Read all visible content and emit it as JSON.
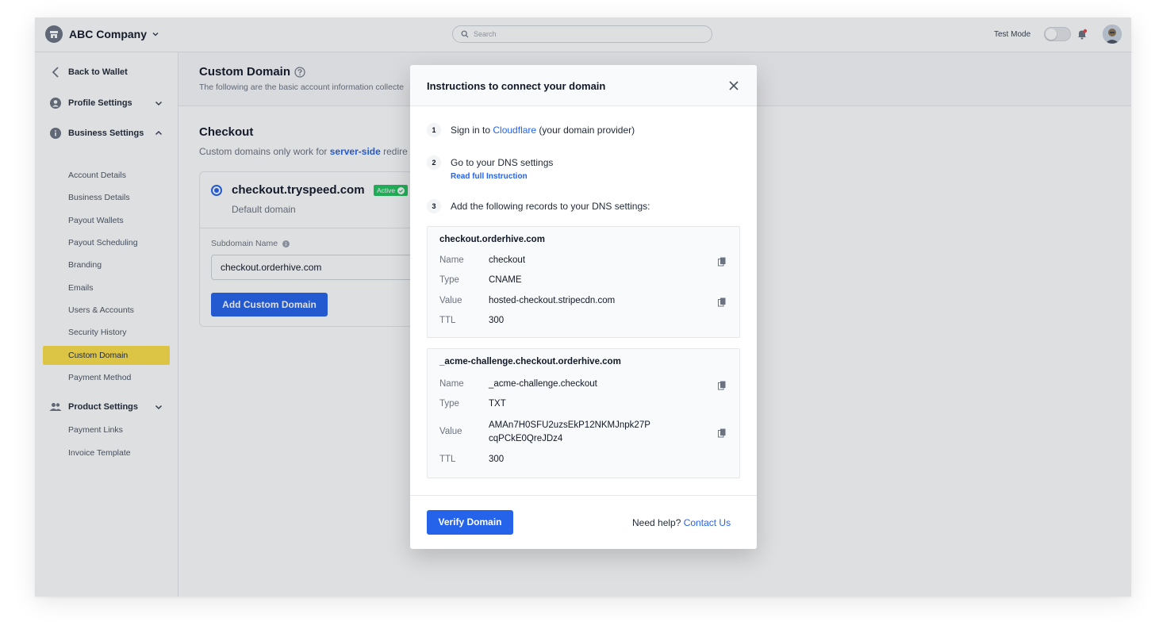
{
  "topbar": {
    "company": "ABC Company",
    "search_placeholder": "Search",
    "test_mode_label": "Test Mode"
  },
  "sidebar": {
    "back": "Back to Wallet",
    "profile_settings": "Profile Settings",
    "business_settings": "Business Settings",
    "business_items": [
      "Account Details",
      "Business Details",
      "Payout Wallets",
      "Payout Scheduling",
      "Branding",
      "Emails",
      "Users & Accounts",
      "Security History",
      "Custom Domain",
      "Payment Method"
    ],
    "product_settings": "Product Settings",
    "product_items": [
      "Payment Links",
      "Invoice Template"
    ]
  },
  "main": {
    "title": "Custom Domain",
    "description": "The following are the basic account information collecte",
    "section_title": "Checkout",
    "section_desc_prefix": "Custom domains only work for ",
    "section_desc_link": "server-side",
    "section_desc_suffix": " redire",
    "domain_name": "checkout.tryspeed.com",
    "badge": "Active",
    "default_label": "Default domain",
    "subdomain_label": "Subdomain Name",
    "subdomain_value": "checkout.orderhive.com",
    "add_button": "Add Custom Domain"
  },
  "modal": {
    "title": "Instructions to connect your domain",
    "steps": [
      {
        "num": "1",
        "prefix": "Sign in to ",
        "link": "Cloudflare",
        "suffix": " (your domain provider)"
      },
      {
        "num": "2",
        "text": "Go to your DNS settings",
        "sub_link": "Read full Instruction"
      },
      {
        "num": "3",
        "text": "Add the following records to your DNS settings:"
      }
    ],
    "records": [
      {
        "title": "checkout.orderhive.com",
        "name_label": "Name",
        "name": "checkout",
        "type_label": "Type",
        "type": "CNAME",
        "value_label": "Value",
        "value": "hosted-checkout.stripecdn.com",
        "ttl_label": "TTL",
        "ttl": "300"
      },
      {
        "title": "_acme-challenge.checkout.orderhive.com",
        "name_label": "Name",
        "name": "_acme-challenge.checkout",
        "type_label": "Type",
        "type": "TXT",
        "value_label": "Value",
        "value_line1": "AMAn7H0SFU2uzsEkP12NKMJnpk27P",
        "value_line2": "cqPCkE0QreJDz4",
        "ttl_label": "TTL",
        "ttl": "300"
      }
    ],
    "verify_button": "Verify Domain",
    "help_prefix": "Need help? ",
    "help_link": "Contact Us"
  },
  "colors": {
    "accent": "#2563eb",
    "highlight": "#fde047",
    "active_badge": "#22c55e"
  }
}
